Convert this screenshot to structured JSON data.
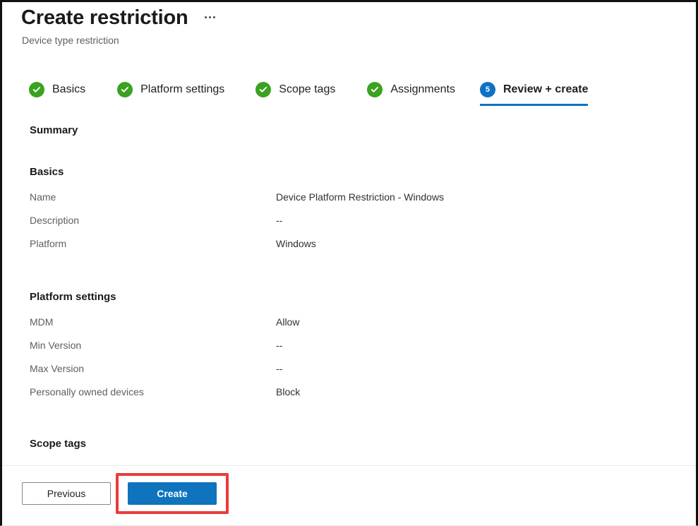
{
  "header": {
    "title": "Create restriction",
    "subtitle": "Device type restriction",
    "more_menu_label": "..."
  },
  "wizard": {
    "steps": [
      {
        "label": "Basics",
        "state": "done",
        "badge": "check"
      },
      {
        "label": "Platform settings",
        "state": "done",
        "badge": "check"
      },
      {
        "label": "Scope tags",
        "state": "done",
        "badge": "check"
      },
      {
        "label": "Assignments",
        "state": "done",
        "badge": "check"
      },
      {
        "label": "Review + create",
        "state": "current",
        "badge": "5"
      }
    ],
    "done_color": "#3aa220",
    "current_color": "#0d72c4"
  },
  "main": {
    "summary_heading": "Summary",
    "sections": [
      {
        "heading": "Basics",
        "rows": [
          {
            "key": "Name",
            "value": "Device Platform Restriction - Windows"
          },
          {
            "key": "Description",
            "value": "--"
          },
          {
            "key": "Platform",
            "value": "Windows"
          }
        ]
      },
      {
        "heading": "Platform settings",
        "rows": [
          {
            "key": "MDM",
            "value": "Allow"
          },
          {
            "key": "Min Version",
            "value": "--"
          },
          {
            "key": "Max Version",
            "value": "--"
          },
          {
            "key": "Personally owned devices",
            "value": "Block"
          }
        ]
      },
      {
        "heading": "Scope tags",
        "rows": []
      }
    ]
  },
  "footer": {
    "previous_label": "Previous",
    "create_label": "Create",
    "primary_color": "#0f74bd",
    "highlight_color": "#ec3a3a"
  }
}
